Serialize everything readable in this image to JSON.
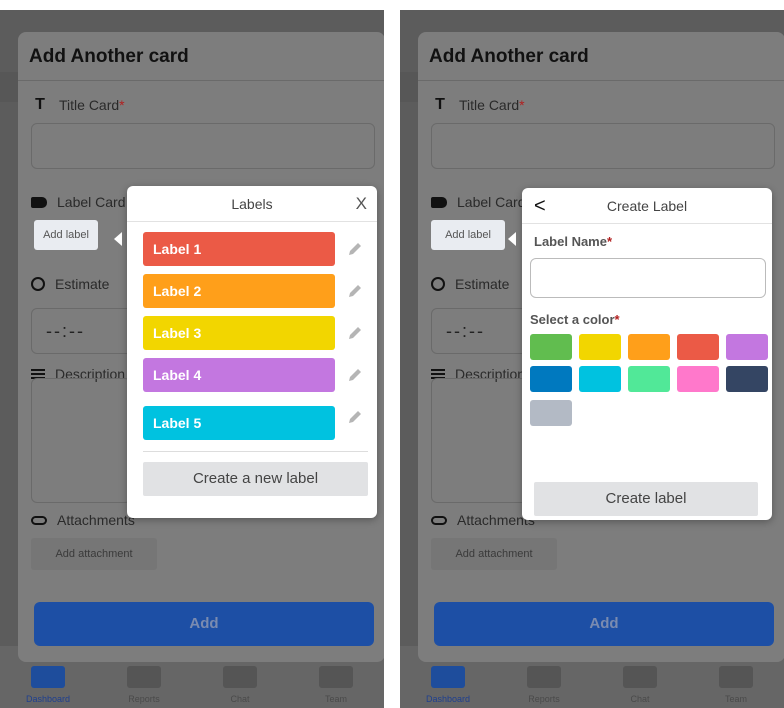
{
  "bottom_nav": {
    "items": [
      {
        "label": "Dashboard"
      },
      {
        "label": "Reports"
      },
      {
        "label": "Chat"
      },
      {
        "label": "Team"
      }
    ]
  },
  "modal": {
    "title": "Add Another card",
    "title_card_label": "Title Card",
    "required_mark": "*",
    "label_card_label": "Label Card",
    "add_label_button": "Add label",
    "estimate_label": "Estimate",
    "time_value": "--:--",
    "description_label": "Description",
    "attachments_label": "Attachments",
    "add_attachment_button": "Add attachment",
    "add_button": "Add"
  },
  "labels_popover": {
    "title": "Labels",
    "close_glyph": "X",
    "labels": [
      {
        "name": "Label 1",
        "color": "#eb5a46"
      },
      {
        "name": "Label 2",
        "color": "#ff9f1a"
      },
      {
        "name": "Label 3",
        "color": "#f2d600"
      },
      {
        "name": "Label 4",
        "color": "#c377e0"
      },
      {
        "name": "Label 5",
        "color": "#00c2e0"
      }
    ],
    "create_button": "Create a new label"
  },
  "create_label_popover": {
    "title": "Create Label",
    "back_glyph": "<",
    "name_label": "Label Name",
    "required_mark": "*",
    "color_label": "Select a color",
    "colors": [
      "#61bd4f",
      "#f2d600",
      "#ff9f1a",
      "#eb5a46",
      "#c377e0",
      "#0079bf",
      "#00c2e0",
      "#51e898",
      "#ff78cb",
      "#344563",
      "#b3bac5"
    ],
    "create_button": "Create label"
  }
}
